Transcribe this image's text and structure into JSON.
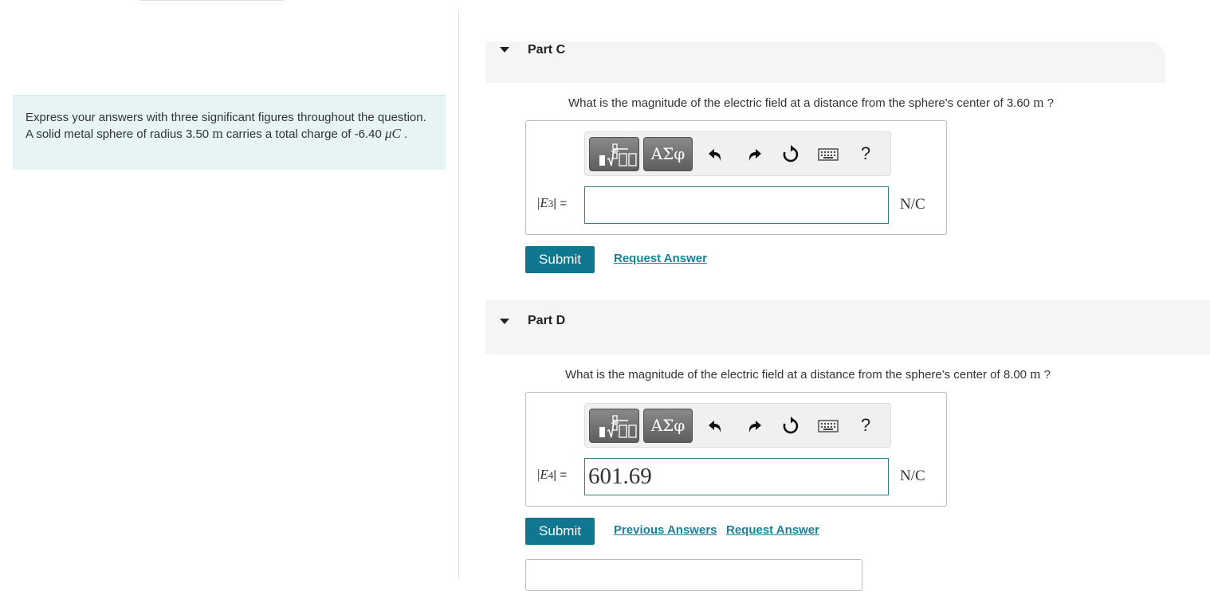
{
  "intro": {
    "text": "Express your answers with three significant figures throughout the question. A solid metal sphere of radius 3.50",
    "radius_unit": "m",
    "text2": "carries a total charge of -6.40",
    "charge_unit": "μC",
    "period": "."
  },
  "toolbar": {
    "greek_label": "ΑΣφ",
    "help_label": "?"
  },
  "part_c": {
    "title": "Part C",
    "question": "What is the magnitude of the electric field at a distance from the sphere's center of 3.60",
    "q_unit": "m",
    "q_end": "?",
    "var_open": "|",
    "var_name": "E",
    "var_sub": "3",
    "var_close": "| =",
    "input_value": "",
    "unit": "N/C",
    "submit_label": "Submit",
    "request_label": "Request Answer"
  },
  "part_d": {
    "title": "Part D",
    "question": "What is the magnitude of the electric field at a distance from the sphere's center of 8.00",
    "q_unit": "m",
    "q_end": "?",
    "var_open": "|",
    "var_name": "E",
    "var_sub": "4",
    "var_close": "| =",
    "input_value": "601.69",
    "unit": "N/C",
    "submit_label": "Submit",
    "previous_label": "Previous Answers",
    "request_label": "Request Answer"
  }
}
